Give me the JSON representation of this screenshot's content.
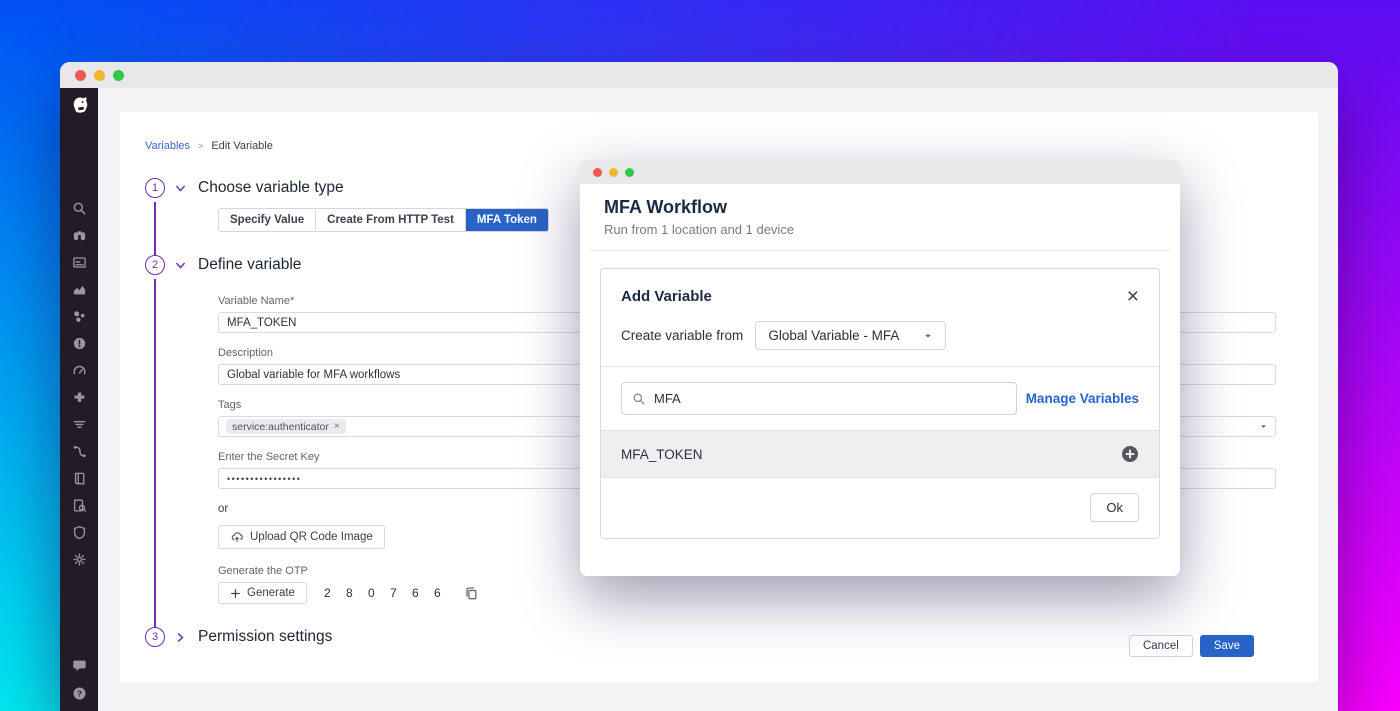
{
  "colors": {
    "accent_blue": "#2a63c8",
    "link_blue": "#3a6ac9",
    "step_purple": "#6e2eb8",
    "gradient_corners": [
      "#0150f5",
      "#5a0df2",
      "#00e9f0",
      "#fb00ff"
    ]
  },
  "sidebar": {
    "icons": [
      "search",
      "watchdog",
      "dashboards",
      "metrics",
      "apm-services",
      "error-tracking",
      "monitors",
      "integrations",
      "logs",
      "ci-pipelines",
      "notebooks",
      "audit-trail",
      "security",
      "settings"
    ],
    "footer_icons": [
      "chat",
      "help"
    ]
  },
  "breadcrumb": {
    "section": "Variables",
    "separator": ">",
    "page": "Edit Variable"
  },
  "steps": {
    "step1": {
      "number": "1",
      "title": "Choose variable type"
    },
    "step2": {
      "number": "2",
      "title": "Define variable"
    },
    "step3": {
      "number": "3",
      "title": "Permission settings"
    }
  },
  "variable_types": {
    "selected": "MFA Token",
    "options": [
      {
        "label": "Specify Value"
      },
      {
        "label": "Create From HTTP Test"
      },
      {
        "label": "MFA Token"
      }
    ]
  },
  "form": {
    "variable_name": {
      "label": "Variable Name*",
      "value": "MFA_TOKEN"
    },
    "description": {
      "label": "Description",
      "value": "Global variable for MFA workflows"
    },
    "tags": {
      "label": "Tags",
      "value": "service:authenticator",
      "remove_icon": "×"
    },
    "secret_key": {
      "label": "Enter the Secret Key",
      "value": "••••••••••••••••"
    },
    "or_text": "or",
    "upload_button_label": "Upload QR Code Image",
    "otp": {
      "label": "Generate the OTP",
      "generate_label": "Generate",
      "digits": "2 8 0 7 6 6"
    }
  },
  "page_actions": {
    "cancel_label": "Cancel",
    "save_label": "Save"
  },
  "modal": {
    "title": "MFA Workflow",
    "subtitle": "Run from 1 location and 1 device",
    "add_variable": {
      "title": "Add Variable",
      "close_icon": "×",
      "create_from_label": "Create variable from",
      "dropdown_value": "Global Variable - MFA",
      "search_value": "MFA",
      "manage_variables_label": "Manage Variables",
      "results": [
        {
          "name": "MFA_TOKEN"
        }
      ],
      "ok_label": "Ok"
    }
  }
}
